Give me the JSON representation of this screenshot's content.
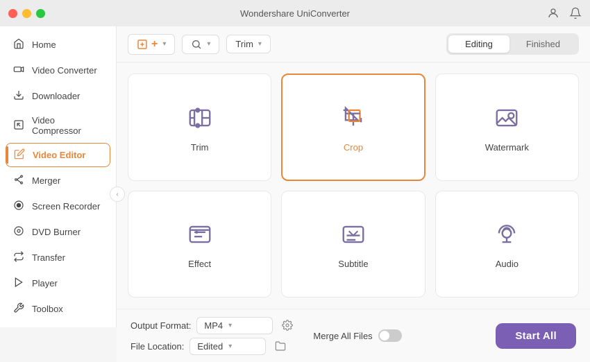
{
  "app": {
    "title": "Wondershare UniConverter"
  },
  "titlebar": {
    "buttons": [
      "red",
      "yellow",
      "green"
    ]
  },
  "sidebar": {
    "items": [
      {
        "id": "home",
        "label": "Home",
        "icon": "home"
      },
      {
        "id": "video-converter",
        "label": "Video Converter",
        "icon": "video"
      },
      {
        "id": "downloader",
        "label": "Downloader",
        "icon": "download"
      },
      {
        "id": "video-compressor",
        "label": "Video Compressor",
        "icon": "compress"
      },
      {
        "id": "video-editor",
        "label": "Video Editor",
        "icon": "edit",
        "active": true
      },
      {
        "id": "merger",
        "label": "Merger",
        "icon": "merge"
      },
      {
        "id": "screen-recorder",
        "label": "Screen Recorder",
        "icon": "record"
      },
      {
        "id": "dvd-burner",
        "label": "DVD Burner",
        "icon": "dvd"
      },
      {
        "id": "transfer",
        "label": "Transfer",
        "icon": "transfer"
      },
      {
        "id": "player",
        "label": "Player",
        "icon": "player"
      },
      {
        "id": "toolbox",
        "label": "Toolbox",
        "icon": "toolbox"
      }
    ]
  },
  "toolbar": {
    "add_button_label": "+",
    "scan_button_label": "",
    "trim_dropdown_label": "Trim",
    "tabs": [
      {
        "id": "editing",
        "label": "Editing",
        "active": true
      },
      {
        "id": "finished",
        "label": "Finished",
        "active": false
      }
    ]
  },
  "grid": {
    "cards": [
      {
        "id": "trim",
        "label": "Trim",
        "selected": false
      },
      {
        "id": "crop",
        "label": "Crop",
        "selected": true
      },
      {
        "id": "watermark",
        "label": "Watermark",
        "selected": false
      },
      {
        "id": "effect",
        "label": "Effect",
        "selected": false
      },
      {
        "id": "subtitle",
        "label": "Subtitle",
        "selected": false
      },
      {
        "id": "audio",
        "label": "Audio",
        "selected": false
      }
    ]
  },
  "bottom": {
    "output_format_label": "Output Format:",
    "output_format_value": "MP4",
    "file_location_label": "File Location:",
    "file_location_value": "Edited",
    "merge_label": "Merge All Files",
    "start_all_label": "Start  All"
  }
}
